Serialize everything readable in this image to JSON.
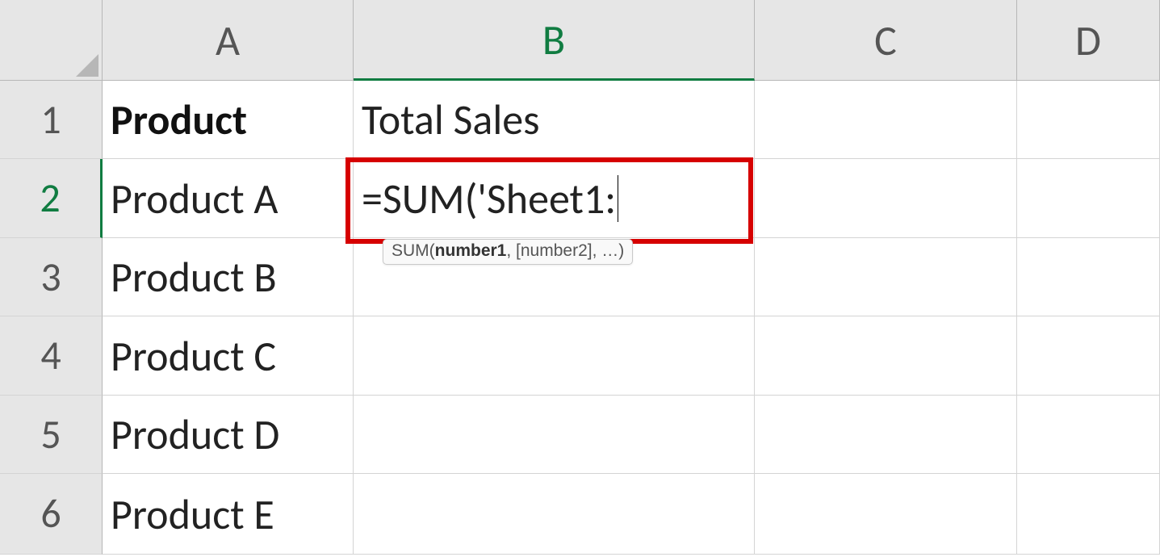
{
  "columns": {
    "A": "A",
    "B": "B",
    "C": "C",
    "D": "D"
  },
  "rows": {
    "r1": "1",
    "r2": "2",
    "r3": "3",
    "r4": "4",
    "r5": "5",
    "r6": "6"
  },
  "cells": {
    "A1": "Product",
    "B1": "Total Sales",
    "A2": "Product A",
    "B2": "=SUM('Sheet1:",
    "A3": "Product B",
    "A4": "Product C",
    "A5": "Product D",
    "A6": "Product E"
  },
  "tooltip": {
    "fn": "SUM(",
    "arg1": "number1",
    "rest": ", [number2], …)"
  },
  "active": {
    "col": "B",
    "row": "2"
  }
}
